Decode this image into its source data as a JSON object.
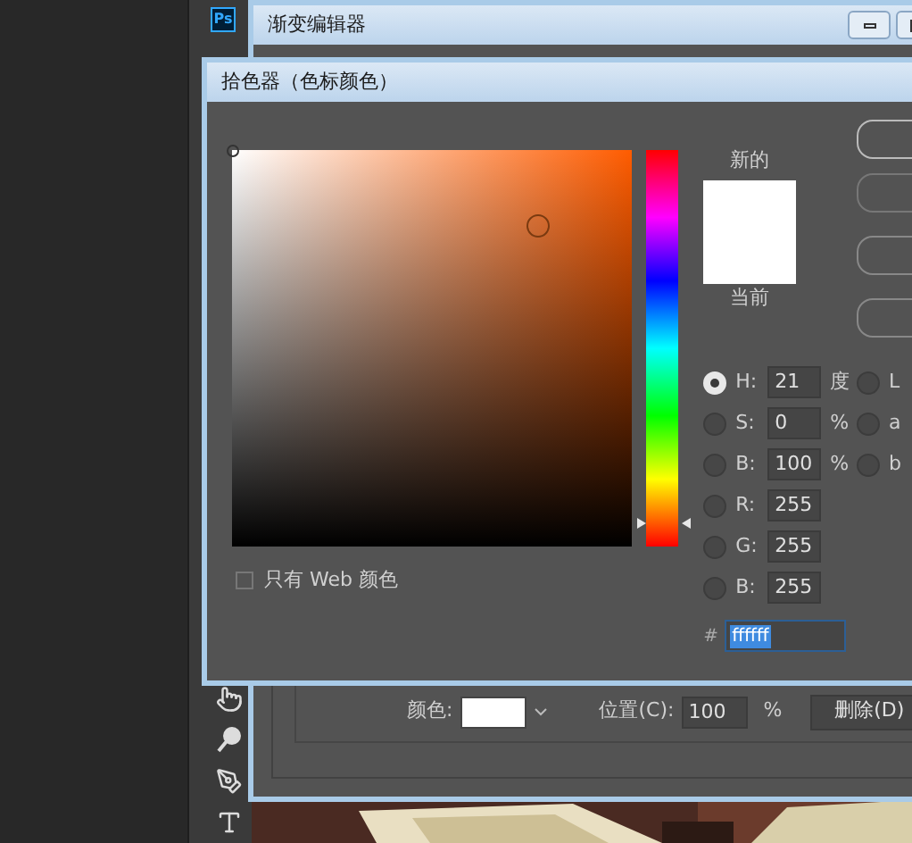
{
  "app": {
    "logo": "Ps"
  },
  "gradient_editor": {
    "title": "渐变编辑器",
    "color_label": "颜色:",
    "location_label": "位置(C):",
    "location_value": "100",
    "location_unit": "%",
    "delete_button": "删除(D)"
  },
  "color_picker": {
    "title": "拾色器（色标颜色）",
    "hue_slider": {
      "level": 0.06
    },
    "new_label": "新的",
    "current_label": "当前",
    "fields": [
      {
        "label": "H:",
        "value": "21",
        "unit": "度",
        "selected": true
      },
      {
        "label": "S:",
        "value": "0",
        "unit": "%",
        "selected": false
      },
      {
        "label": "B:",
        "value": "100",
        "unit": "%",
        "selected": false
      },
      {
        "label": "R:",
        "value": "255",
        "selected": false
      },
      {
        "label": "G:",
        "value": "255",
        "selected": false
      },
      {
        "label": "B:",
        "value": "255",
        "selected": false
      }
    ],
    "lab_fields": [
      {
        "label": "L",
        "selected": false
      },
      {
        "label": "a",
        "selected": false
      },
      {
        "label": "b",
        "selected": false
      }
    ],
    "hex": {
      "label": "#",
      "value": "ffffff"
    },
    "web_only": {
      "label": "只有 Web 颜色",
      "checked": false
    }
  }
}
